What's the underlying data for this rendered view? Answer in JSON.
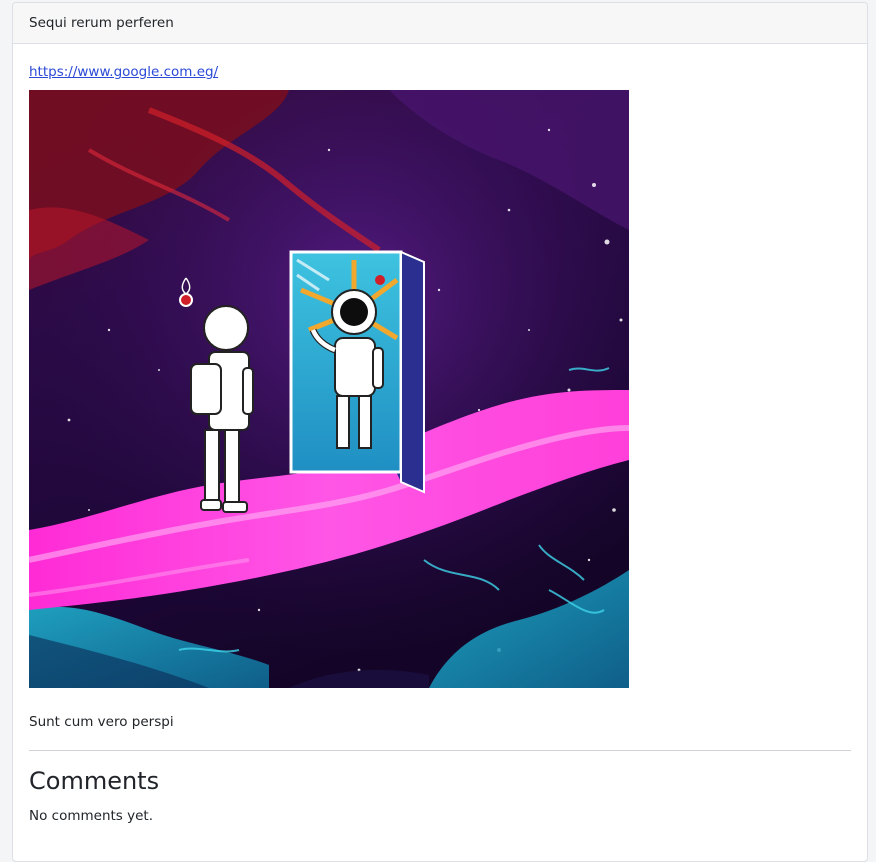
{
  "post": {
    "title": "Sequi rerum perferen",
    "link": "https://www.google.com.eg/",
    "image_alt": "astronaut-door-space-illustration",
    "body": "Sunt cum vero perspi"
  },
  "comments": {
    "heading": "Comments",
    "empty_text": "No comments yet."
  },
  "colors": {
    "link": "#2a49d6",
    "header_bg": "#f7f7f7",
    "border": "#dcdfe3"
  }
}
